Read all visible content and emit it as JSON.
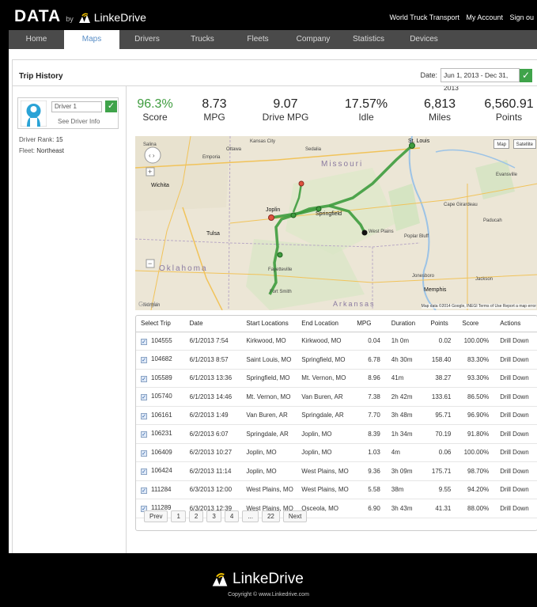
{
  "brand": {
    "data": "DATA",
    "by": "by",
    "name": "LinkeDrive"
  },
  "toplinks": [
    "World Truck Transport",
    "My Account",
    "Sign ou"
  ],
  "nav": [
    "Home",
    "Maps",
    "Drivers",
    "Trucks",
    "Fleets",
    "Company",
    "Statistics",
    "Devices"
  ],
  "nav_active": "Maps",
  "page_title": "Trip History",
  "date": {
    "label": "Date:",
    "value": "Jun 1, 2013 - Dec 31, 2013"
  },
  "driver": {
    "select_value": "Driver 1",
    "see_info": "See Driver Info",
    "rank_label": "Driver Rank:",
    "rank": "15",
    "fleet_label": "Fleet:",
    "fleet": "Northeast"
  },
  "stats": [
    {
      "value": "96.3%",
      "label": "Score"
    },
    {
      "value": "8.73",
      "label": "MPG"
    },
    {
      "value": "9.07",
      "label": "Drive MPG"
    },
    {
      "value": "17.57%",
      "label": "Idle"
    },
    {
      "value": "6,813",
      "label": "Miles"
    },
    {
      "value": "6,560.91",
      "label": "Points"
    }
  ],
  "map": {
    "buttons": [
      "Map",
      "Satellite"
    ],
    "attribution": "Map data ©2014 Google, INEGI   Terms of Use   Report a map error",
    "google": "Google",
    "labels": [
      {
        "text": "Salina"
      },
      {
        "text": "Kansas City"
      },
      {
        "text": "Ottawa"
      },
      {
        "text": "Sedalia"
      },
      {
        "text": "Missouri"
      },
      {
        "text": "St. Louis"
      },
      {
        "text": "Wichita"
      },
      {
        "text": "Emporia"
      },
      {
        "text": "Joplin"
      },
      {
        "text": "Springfield"
      },
      {
        "text": "Tulsa"
      },
      {
        "text": "Fayetteville"
      },
      {
        "text": "Oklahoma"
      },
      {
        "text": "Arkansas"
      },
      {
        "text": "Evansville"
      },
      {
        "text": "Memphis"
      },
      {
        "text": "Fort Smith"
      },
      {
        "text": "Jonesboro"
      },
      {
        "text": "Poplar Bluff"
      },
      {
        "text": "West Plains"
      },
      {
        "text": "Norman"
      },
      {
        "text": "Jackson"
      },
      {
        "text": "Paducah"
      },
      {
        "text": "Cape Girardeau"
      }
    ]
  },
  "table": {
    "headers": [
      "Select Trip",
      "Date",
      "Start Locations",
      "End Location",
      "MPG",
      "Duration",
      "Points",
      "Score",
      "Actions"
    ],
    "rows": [
      [
        "104555",
        "6/1/2013 7:54",
        "Kirkwood, MO",
        "Kirkwood, MO",
        "0.04",
        "1h 0m",
        "0.02",
        "100.00%",
        "Drill Down"
      ],
      [
        "104682",
        "6/1/2013 8:57",
        "Saint Louis, MO",
        "Springfield, MO",
        "6.78",
        "4h 30m",
        "158.40",
        "83.30%",
        "Drill Down"
      ],
      [
        "105589",
        "6/1/2013 13:36",
        "Springfield, MO",
        "Mt. Vernon, MO",
        "8.96",
        "41m",
        "38.27",
        "93.30%",
        "Drill Down"
      ],
      [
        "105740",
        "6/1/2013 14:46",
        "Mt. Vernon, MO",
        "Van Buren, AR",
        "7.38",
        "2h 42m",
        "133.61",
        "86.50%",
        "Drill Down"
      ],
      [
        "106161",
        "6/2/2013 1:49",
        "Van Buren, AR",
        "Springdale, AR",
        "7.70",
        "3h 48m",
        "95.71",
        "96.90%",
        "Drill Down"
      ],
      [
        "106231",
        "6/2/2013 6:07",
        "Springdale, AR",
        "Joplin, MO",
        "8.39",
        "1h 34m",
        "70.19",
        "91.80%",
        "Drill Down"
      ],
      [
        "106409",
        "6/2/2013 10:27",
        "Joplin, MO",
        "Joplin, MO",
        "1.03",
        "4m",
        "0.06",
        "100.00%",
        "Drill Down"
      ],
      [
        "106424",
        "6/2/2013 11:14",
        "Joplin, MO",
        "West Plains, MO",
        "9.36",
        "3h 09m",
        "175.71",
        "98.70%",
        "Drill Down"
      ],
      [
        "111284",
        "6/3/2013 12:00",
        "West Plains, MO",
        "West Plains, MO",
        "5.58",
        "38m",
        "9.55",
        "94.20%",
        "Drill Down"
      ],
      [
        "111289",
        "6/3/2013 12:39",
        "West Plains, MO",
        "Osceola, MO",
        "6.90",
        "3h 43m",
        "41.31",
        "88.00%",
        "Drill Down"
      ]
    ]
  },
  "pager": [
    "Prev",
    "1",
    "2",
    "3",
    "4",
    "...",
    "22",
    "Next"
  ],
  "footer": {
    "name": "LinkeDrive",
    "copyright": "Copyright ©  www.Linkedrive.com"
  },
  "colors": {
    "accent_green": "#3fa34a",
    "nav_bg": "#4a4a4a",
    "active_tab_text": "#5a8fc7",
    "route": "#3e9c3e"
  }
}
